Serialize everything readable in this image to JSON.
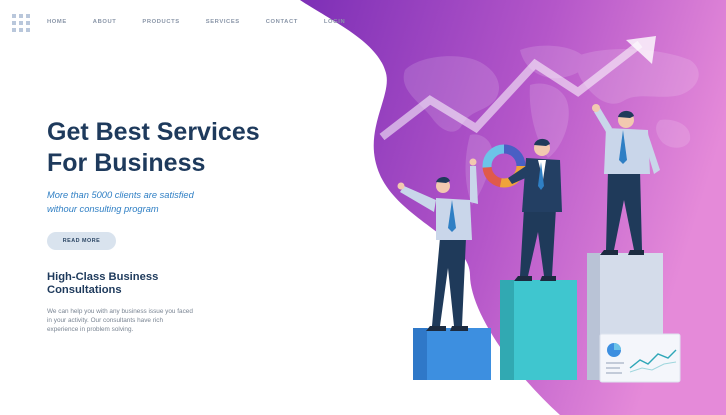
{
  "header": {
    "nav": [
      {
        "label": "HOME"
      },
      {
        "label": "ABOUT"
      },
      {
        "label": "PRODUCTS"
      },
      {
        "label": "SERVICES"
      },
      {
        "label": "CONTACT"
      },
      {
        "label": "LOGIN"
      }
    ]
  },
  "hero": {
    "headline_line1": "Get Best Services",
    "headline_line2": "For Business",
    "subtitle_line1": "More than 5000 clients are satisfied",
    "subtitle_line2": "withour consulting program",
    "button_label": "READ MORE"
  },
  "section": {
    "title_line1": "High-Class Business",
    "title_line2": "Consultations",
    "body_line1": "We can help you with any business issue you faced",
    "body_line2": "in your activity. Our consultants have rich",
    "body_line3": "experience in problem solving."
  },
  "colors": {
    "heading": "#1e3a5c",
    "accent_text": "#2f7fc4",
    "gradient_start": "#7d2fb6",
    "gradient_end": "#e07ad6",
    "button_bg": "#d9e3ee"
  },
  "icons": [
    "logo-grid-icon",
    "trend-arrow-icon",
    "world-map-icon",
    "pie-chart-icon",
    "line-chart-icon"
  ]
}
